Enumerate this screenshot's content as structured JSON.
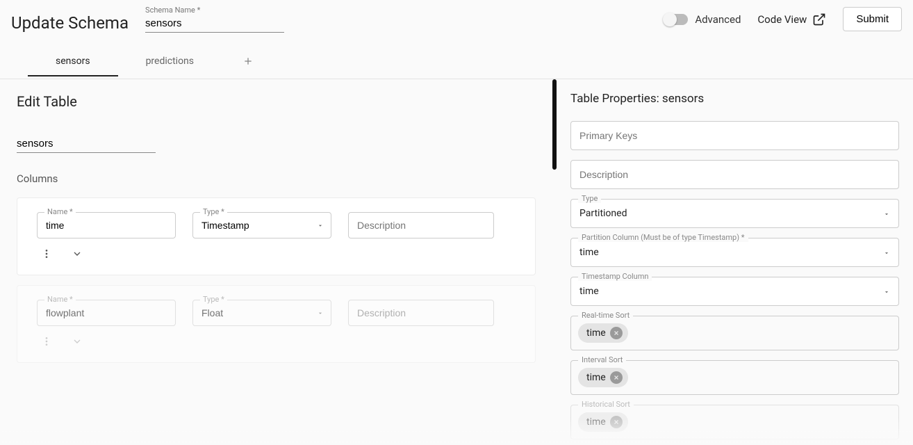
{
  "header": {
    "title": "Update Schema",
    "schema_name_label": "Schema Name *",
    "schema_name_value": "sensors",
    "advanced_label": "Advanced",
    "code_view_label": "Code View",
    "submit_label": "Submit"
  },
  "tabs": [
    {
      "label": "sensors"
    },
    {
      "label": "predictions"
    }
  ],
  "edit": {
    "title": "Edit Table",
    "table_name": "sensors",
    "columns_label": "Columns"
  },
  "columns": [
    {
      "name_label": "Name *",
      "name_value": "time",
      "type_label": "Type *",
      "type_value": "Timestamp",
      "desc_placeholder": "Description"
    },
    {
      "name_label": "Name *",
      "name_value": "flowplant",
      "type_label": "Type *",
      "type_value": "Float",
      "desc_placeholder": "Description"
    }
  ],
  "props": {
    "title": "Table Properties: sensors",
    "primary_keys_placeholder": "Primary Keys",
    "description_placeholder": "Description",
    "type_label": "Type",
    "type_value": "Partitioned",
    "partition_label": "Partition Column (Must be of type Timestamp) *",
    "partition_value": "time",
    "timestamp_label": "Timestamp Column",
    "timestamp_value": "time",
    "realtime_label": "Real-time Sort",
    "realtime_chip": "time",
    "interval_label": "Interval Sort",
    "interval_chip": "time",
    "historical_label": "Historical Sort",
    "historical_chip": "time"
  }
}
